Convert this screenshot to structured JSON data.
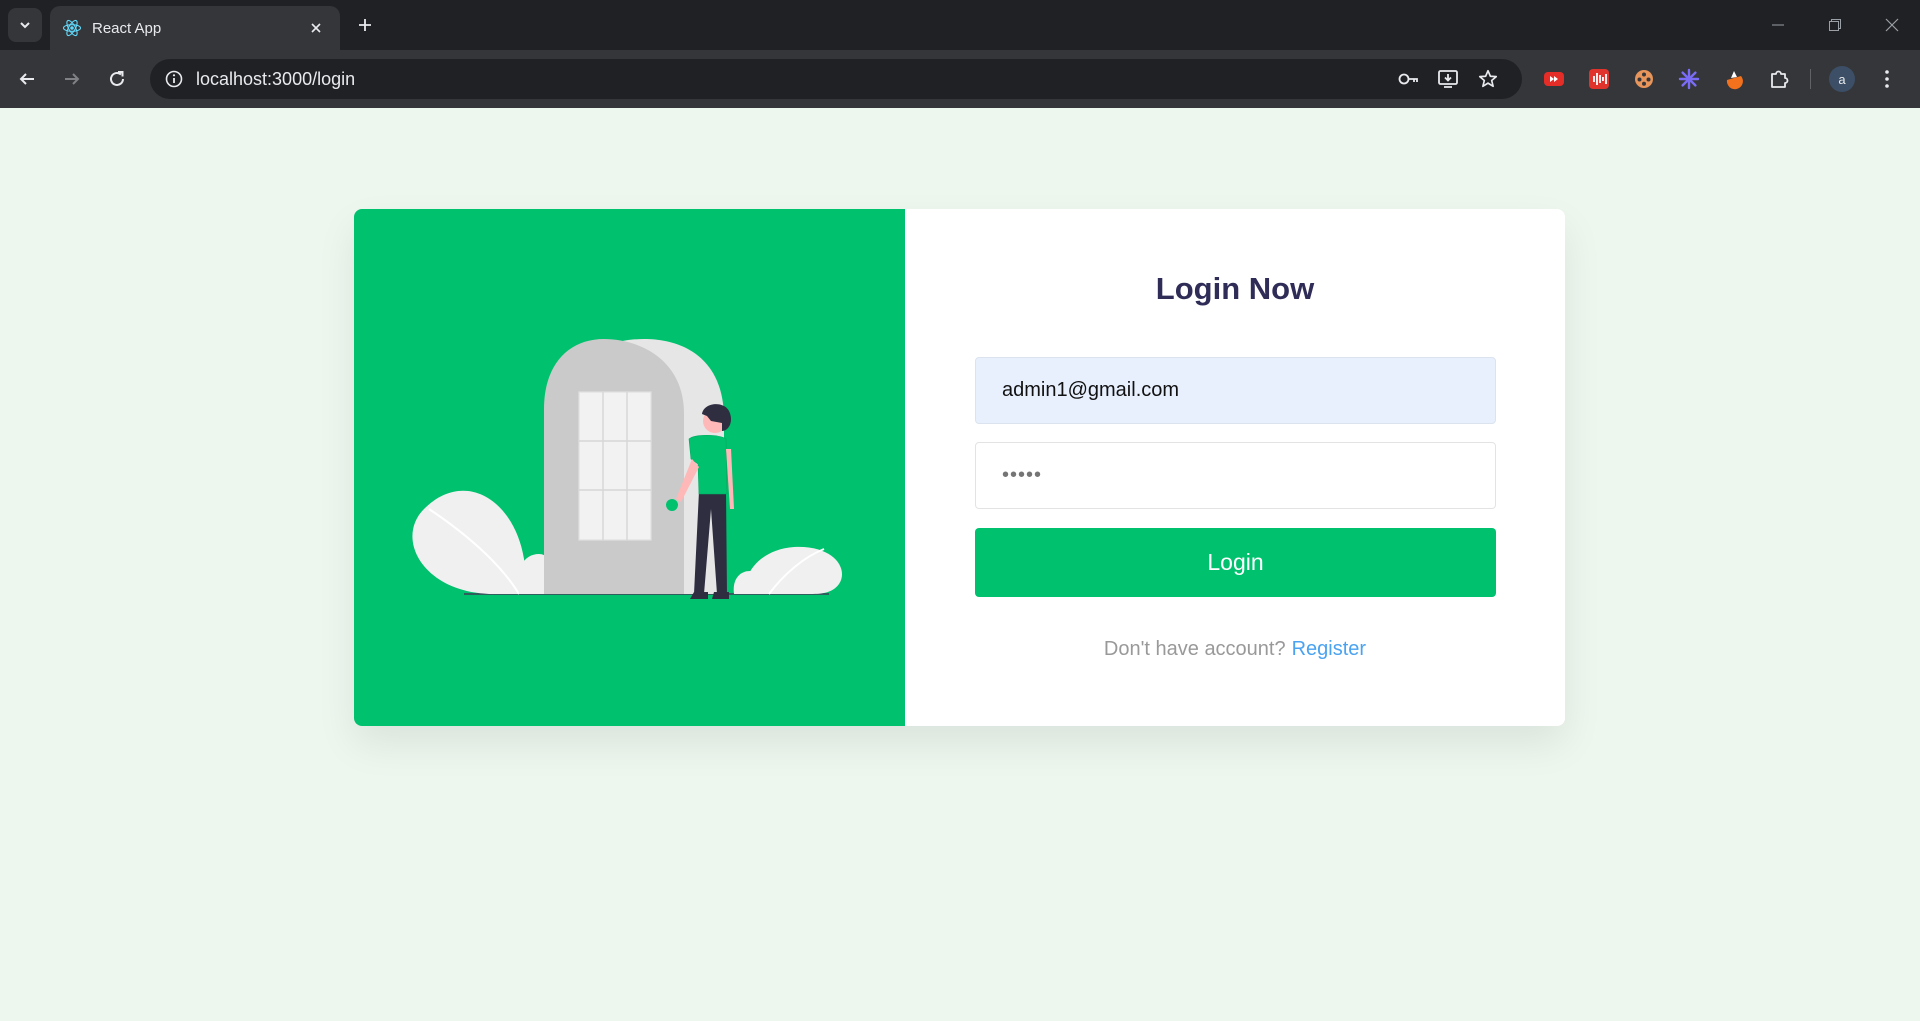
{
  "browser": {
    "tab_title": "React App",
    "url": "localhost:3000/login",
    "profile_initial": "a"
  },
  "login": {
    "title": "Login Now",
    "email_value": "admin1@gmail.com",
    "password_mask": "•••••",
    "button_label": "Login",
    "register_prompt": "Don't have account?",
    "register_link": "Register"
  },
  "colors": {
    "brand_green": "#00c16e",
    "title_navy": "#2f2d57",
    "link_blue": "#4aa3f0",
    "page_bg": "#edf7ee"
  }
}
